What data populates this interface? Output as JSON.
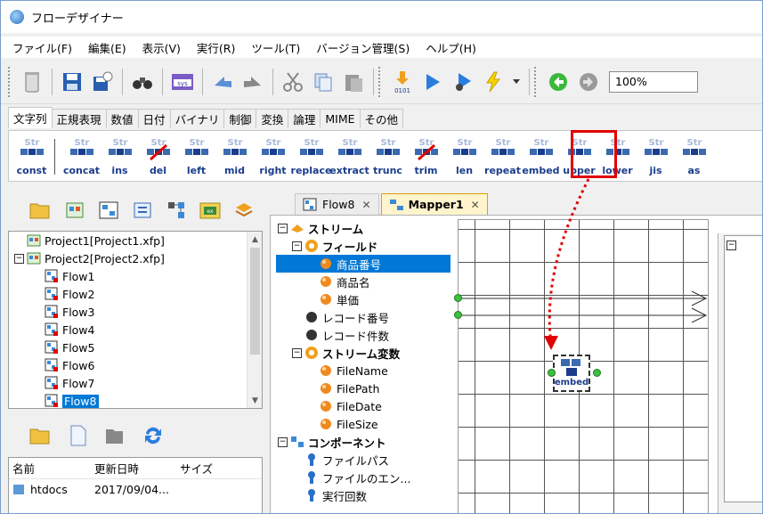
{
  "window": {
    "title": "フローデザイナー"
  },
  "menu": [
    "ファイル(F)",
    "編集(E)",
    "表示(V)",
    "実行(R)",
    "ツール(T)",
    "バージョン管理(S)",
    "ヘルプ(H)"
  ],
  "toolbar": {
    "zoom": "100%"
  },
  "function_tabs": [
    "文字列",
    "正規表現",
    "数値",
    "日付",
    "バイナリ",
    "制御",
    "変換",
    "論理",
    "MIME",
    "その他"
  ],
  "functions": [
    "const",
    "concat",
    "ins",
    "del",
    "left",
    "mid",
    "right",
    "replace",
    "extract",
    "trunc",
    "trim",
    "len",
    "repeat",
    "embed",
    "upper",
    "lower",
    "jis",
    "as"
  ],
  "project_tree": [
    {
      "label": "Project1[Project1.xfp]",
      "type": "project"
    },
    {
      "label": "Project2[Project2.xfp]",
      "type": "project"
    },
    {
      "label": "Flow1",
      "type": "flow"
    },
    {
      "label": "Flow2",
      "type": "flow"
    },
    {
      "label": "Flow3",
      "type": "flow"
    },
    {
      "label": "Flow4",
      "type": "flow"
    },
    {
      "label": "Flow5",
      "type": "flow"
    },
    {
      "label": "Flow6",
      "type": "flow"
    },
    {
      "label": "Flow7",
      "type": "flow"
    },
    {
      "label": "Flow8",
      "type": "flow",
      "selected": true
    }
  ],
  "file_list": {
    "headers": [
      "名前",
      "更新日時",
      "サイズ"
    ],
    "rows": [
      {
        "name": "htdocs",
        "updated": "2017/09/04...",
        "size": ""
      }
    ]
  },
  "editor_tabs": [
    {
      "label": "Flow8",
      "active": false
    },
    {
      "label": "Mapper1",
      "active": true
    }
  ],
  "stream_tree": [
    {
      "label": "ストリーム",
      "bold": true,
      "level": 0,
      "toggle": "−"
    },
    {
      "label": "フィールド",
      "bold": true,
      "level": 1,
      "toggle": "−"
    },
    {
      "label": "商品番号",
      "level": 2,
      "selected": true
    },
    {
      "label": "商品名",
      "level": 2
    },
    {
      "label": "単価",
      "level": 2
    },
    {
      "label": "レコード番号",
      "level": 1
    },
    {
      "label": "レコード件数",
      "level": 1
    },
    {
      "label": "ストリーム変数",
      "bold": true,
      "level": 1,
      "toggle": "−"
    },
    {
      "label": "FileName",
      "level": 2
    },
    {
      "label": "FilePath",
      "level": 2
    },
    {
      "label": "FileDate",
      "level": 2
    },
    {
      "label": "FileSize",
      "level": 2
    },
    {
      "label": "コンポーネント",
      "bold": true,
      "level": 0,
      "toggle": "−"
    },
    {
      "label": "ファイルパス",
      "level": 1
    },
    {
      "label": "ファイルのエン...",
      "level": 1
    },
    {
      "label": "実行回数",
      "level": 1
    }
  ],
  "mapper_node": {
    "label": "embed"
  },
  "colors": {
    "highlight_box": "#e00000",
    "selection": "#0078d7",
    "function_label": "#1a3c8c"
  }
}
